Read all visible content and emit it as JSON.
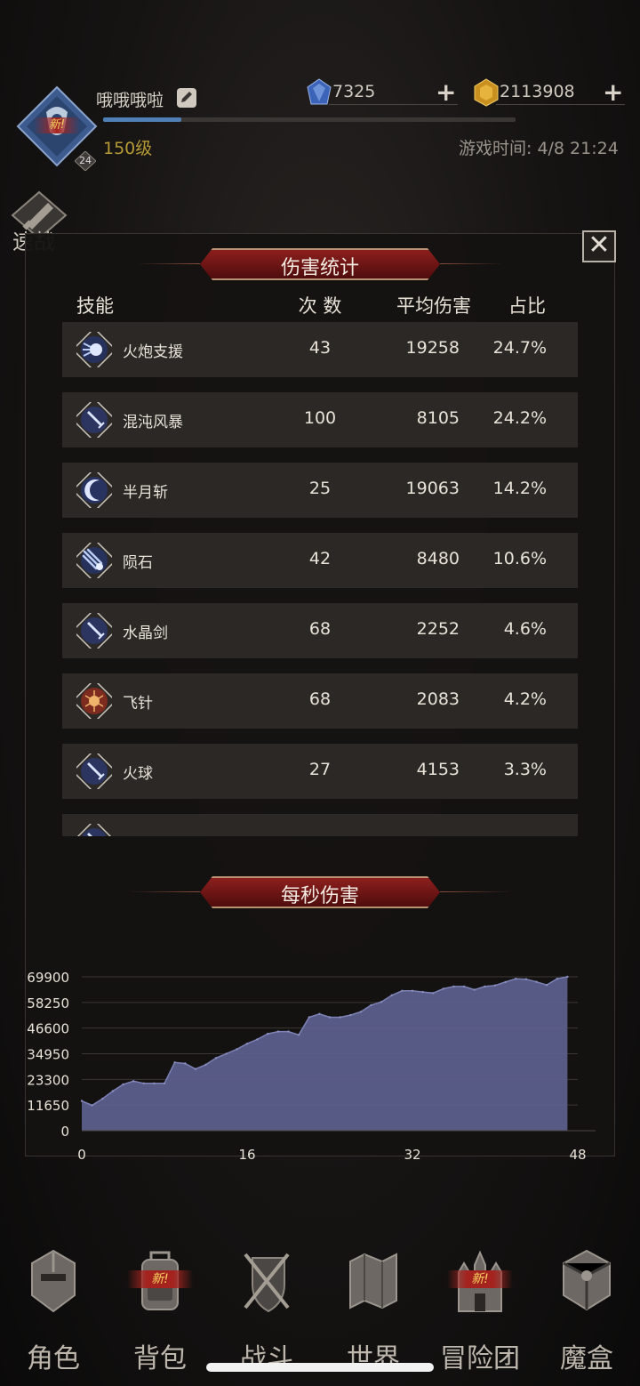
{
  "player": {
    "name": "哦哦哦啦",
    "level": "150级",
    "avatar_level": "24",
    "new_badge": "新!"
  },
  "currency": {
    "gems": "7325",
    "gold": "2113908"
  },
  "game_time": "游戏时间: 4/8 21:24",
  "speed_button": "速战",
  "stats_panel": {
    "title": "伤害统计",
    "headers": {
      "skill": "技能",
      "count": "次 数",
      "avg": "平均伤害",
      "ratio": "占比"
    },
    "rows": [
      {
        "name": "火炮支援",
        "count": "43",
        "avg": "19258",
        "ratio": "24.7%",
        "icon": "cannon-support-icon"
      },
      {
        "name": "混沌风暴",
        "count": "100",
        "avg": "8105",
        "ratio": "24.2%",
        "icon": "chaos-storm-icon"
      },
      {
        "name": "半月斩",
        "count": "25",
        "avg": "19063",
        "ratio": "14.2%",
        "icon": "half-moon-slash-icon"
      },
      {
        "name": "陨石",
        "count": "42",
        "avg": "8480",
        "ratio": "10.6%",
        "icon": "meteor-icon"
      },
      {
        "name": "水晶剑",
        "count": "68",
        "avg": "2252",
        "ratio": "4.6%",
        "icon": "crystal-sword-icon"
      },
      {
        "name": "飞针",
        "count": "68",
        "avg": "2083",
        "ratio": "4.2%",
        "icon": "flying-needle-icon"
      },
      {
        "name": "火球",
        "count": "27",
        "avg": "4153",
        "ratio": "3.3%",
        "icon": "fireball-icon"
      }
    ]
  },
  "dps_section": {
    "title": "每秒伤害"
  },
  "chart_data": {
    "type": "area",
    "x": [
      0,
      1,
      2,
      3,
      4,
      5,
      6,
      7,
      8,
      9,
      10,
      11,
      12,
      13,
      14,
      15,
      16,
      17,
      18,
      19,
      20,
      21,
      22,
      23,
      24,
      25,
      26,
      27,
      28,
      29,
      30,
      31,
      32,
      33,
      34,
      35,
      36,
      37,
      38,
      39,
      40,
      41,
      42,
      43,
      44,
      45,
      46,
      47
    ],
    "values": [
      13500,
      11500,
      14500,
      18000,
      21000,
      22500,
      21500,
      21500,
      21500,
      31000,
      30500,
      28000,
      30000,
      33000,
      35000,
      37000,
      39500,
      41500,
      44000,
      45000,
      45000,
      43500,
      51500,
      53000,
      51500,
      51500,
      52500,
      54000,
      57000,
      58500,
      61500,
      63500,
      63500,
      63000,
      62500,
      64500,
      65500,
      65500,
      64000,
      65500,
      66000,
      67500,
      69000,
      68800,
      67600,
      66200,
      69000,
      69900
    ],
    "xticks": [
      "0",
      "16",
      "32",
      "48"
    ],
    "yticks": [
      "0",
      "11650",
      "23300",
      "34950",
      "46600",
      "58250",
      "69900"
    ],
    "xlim": [
      0,
      48
    ],
    "ylim": [
      0,
      69900
    ],
    "grid": true,
    "fill_color": "#5d618e"
  },
  "nav": [
    {
      "label": "角色",
      "icon": "helmet-icon"
    },
    {
      "label": "背包",
      "icon": "backpack-icon",
      "badge": "新!"
    },
    {
      "label": "战斗",
      "icon": "swords-shield-icon"
    },
    {
      "label": "世界",
      "icon": "world-map-icon"
    },
    {
      "label": "冒险团",
      "icon": "castle-icon",
      "badge": "新!"
    },
    {
      "label": "魔盒",
      "icon": "magic-box-icon"
    }
  ]
}
